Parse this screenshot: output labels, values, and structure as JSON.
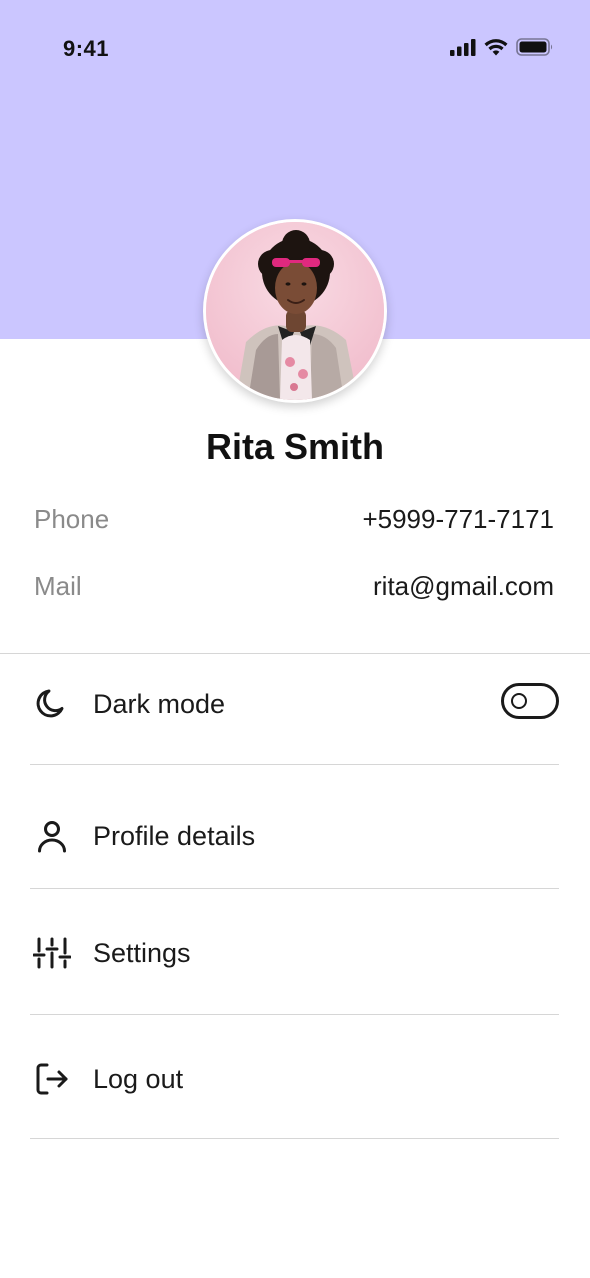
{
  "status_bar": {
    "time": "9:41",
    "icons": [
      "cellular-signal-icon",
      "wifi-icon",
      "battery-icon"
    ]
  },
  "theme": {
    "header_color": "#cbc6ff",
    "text_color": "#1a1a1a",
    "muted_color": "#8a8a8a",
    "divider_color": "#d6d6d6"
  },
  "profile": {
    "name": "Rita Smith",
    "avatar": "profile-photo",
    "phone_label": "Phone",
    "phone_value": "+5999-771-7171",
    "mail_label": "Mail",
    "mail_value": "rita@gmail.com"
  },
  "menu": {
    "dark_mode": {
      "label": "Dark mode",
      "icon": "moon-icon",
      "enabled": false
    },
    "profile_details": {
      "label": "Profile details",
      "icon": "user-icon"
    },
    "settings": {
      "label": "Settings",
      "icon": "sliders-icon"
    },
    "log_out": {
      "label": "Log out",
      "icon": "logout-icon"
    }
  }
}
